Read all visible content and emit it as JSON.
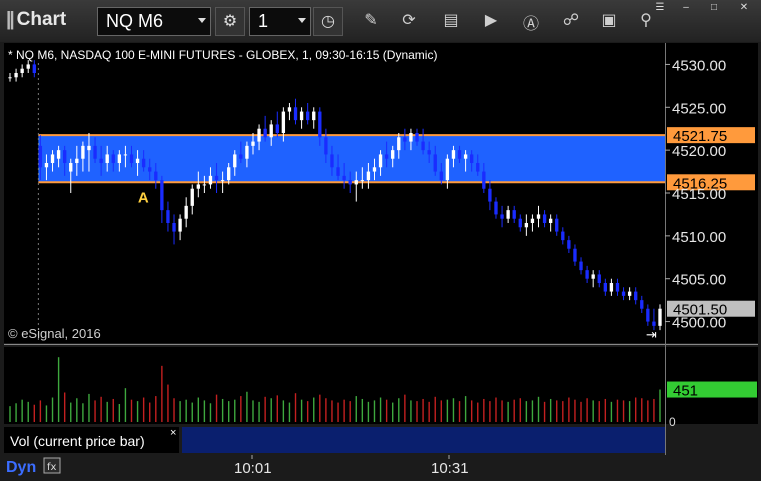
{
  "toolbar": {
    "app_title": "Chart",
    "symbol": "NQ M6",
    "interval": "1",
    "chart_title": "* NQ M6, NASDAQ 100 E-MINI FUTURES - GLOBEX, 1, 09:30-16:15 (Dynamic)",
    "copyright": "© eSignal, 2016",
    "dyn_label": "Dyn",
    "vol_panel_label": "Vol (current price bar)",
    "vol_close_glyph": "×",
    "note_letter": "A"
  },
  "colors": {
    "background": "#000000",
    "zone_fill": "#1f62ff",
    "zone_border": "#ff9a3c",
    "up_candle": "#ffffff",
    "down_candle": "#1a2cff",
    "vol_up": "#3ea83e",
    "vol_down": "#c42020",
    "last_price_tag": "#bfbfbf",
    "vol_tag": "#33cc33"
  },
  "chart_data": [
    {
      "type": "candlestick",
      "title": "* NQ M6, NASDAQ 100 E-MINI FUTURES - GLOBEX, 1, 09:30-16:15 (Dynamic)",
      "y_ticks": [
        "4530.00",
        "4525.00",
        "4520.00",
        "4515.00",
        "4510.00",
        "4505.00",
        "4500.00"
      ],
      "ylim": [
        4497.5,
        4532.5
      ],
      "x_ticks": [
        "10:01",
        "10:31"
      ],
      "zone": {
        "low": 4516.25,
        "high": 4521.75,
        "labels": [
          "4521.75",
          "4516.25"
        ]
      },
      "last_price": 4501.5,
      "last_price_label": "4501.50",
      "annotations": [
        {
          "text": "A",
          "bar": 25,
          "price": 4514.5
        }
      ],
      "bars": [
        [
          4528.5,
          4529.0,
          4528.0,
          4528.5
        ],
        [
          4528.5,
          4529.5,
          4528.0,
          4529.0
        ],
        [
          4529.0,
          4530.0,
          4528.5,
          4529.5
        ],
        [
          4529.5,
          4530.5,
          4529.0,
          4530.0
        ],
        [
          4530.0,
          4530.5,
          4528.5,
          4529.0
        ],
        [
          4520.5,
          4521.75,
          4516.5,
          4518.0
        ],
        [
          4518.0,
          4519.5,
          4516.5,
          4518.5
        ],
        [
          4518.5,
          4520.0,
          4517.5,
          4519.5
        ],
        [
          4519.0,
          4520.5,
          4518.0,
          4520.0
        ],
        [
          4520.0,
          4520.5,
          4517.0,
          4518.5
        ],
        [
          4517.5,
          4519.0,
          4515.0,
          4518.5
        ],
        [
          4518.5,
          4520.5,
          4517.0,
          4519.0
        ],
        [
          4519.0,
          4521.0,
          4517.5,
          4520.5
        ],
        [
          4520.0,
          4522.0,
          4517.5,
          4520.5
        ],
        [
          4520.5,
          4521.5,
          4518.5,
          4519.0
        ],
        [
          4519.0,
          4520.5,
          4517.0,
          4518.5
        ],
        [
          4518.5,
          4520.5,
          4517.5,
          4519.5
        ],
        [
          4519.5,
          4520.0,
          4517.5,
          4518.5
        ],
        [
          4518.5,
          4520.0,
          4517.5,
          4519.5
        ],
        [
          4519.5,
          4520.5,
          4518.0,
          4519.5
        ],
        [
          4519.5,
          4520.5,
          4518.0,
          4518.5
        ],
        [
          4518.5,
          4520.0,
          4517.0,
          4519.0
        ],
        [
          4519.0,
          4520.0,
          4517.5,
          4518.0
        ],
        [
          4518.0,
          4519.0,
          4516.5,
          4517.5
        ],
        [
          4517.5,
          4518.5,
          4515.5,
          4516.5
        ],
        [
          4516.5,
          4517.0,
          4511.5,
          4513.0
        ],
        [
          4513.0,
          4514.0,
          4510.5,
          4511.5
        ],
        [
          4511.5,
          4512.5,
          4509.0,
          4510.5
        ],
        [
          4510.5,
          4512.5,
          4509.5,
          4512.0
        ],
        [
          4512.0,
          4514.5,
          4511.0,
          4513.5
        ],
        [
          4513.5,
          4516.0,
          4512.5,
          4515.5
        ],
        [
          4515.5,
          4517.5,
          4514.5,
          4516.0
        ],
        [
          4516.0,
          4517.0,
          4515.0,
          4516.0
        ],
        [
          4516.0,
          4518.0,
          4515.5,
          4517.0
        ],
        [
          4517.0,
          4518.5,
          4515.0,
          4516.5
        ],
        [
          4516.5,
          4517.5,
          4515.0,
          4516.5
        ],
        [
          4516.5,
          4518.5,
          4516.0,
          4518.0
        ],
        [
          4518.0,
          4520.0,
          4517.0,
          4519.5
        ],
        [
          4519.5,
          4521.0,
          4518.5,
          4519.0
        ],
        [
          4519.0,
          4521.0,
          4518.0,
          4520.5
        ],
        [
          4520.5,
          4522.0,
          4519.5,
          4521.0
        ],
        [
          4521.0,
          4523.0,
          4520.0,
          4522.5
        ],
        [
          4522.5,
          4524.0,
          4521.0,
          4521.5
        ],
        [
          4521.5,
          4523.5,
          4520.5,
          4523.0
        ],
        [
          4523.0,
          4524.5,
          4521.5,
          4522.0
        ],
        [
          4522.0,
          4525.0,
          4521.0,
          4524.5
        ],
        [
          4524.5,
          4525.5,
          4523.5,
          4525.0
        ],
        [
          4525.0,
          4526.0,
          4523.0,
          4523.5
        ],
        [
          4523.5,
          4525.0,
          4522.5,
          4524.5
        ],
        [
          4524.5,
          4525.5,
          4523.0,
          4523.5
        ],
        [
          4523.5,
          4525.0,
          4522.5,
          4524.5
        ],
        [
          4524.5,
          4525.0,
          4520.5,
          4521.5
        ],
        [
          4521.5,
          4522.5,
          4518.5,
          4519.5
        ],
        [
          4519.5,
          4520.5,
          4517.0,
          4518.0
        ],
        [
          4518.0,
          4519.5,
          4516.5,
          4517.0
        ],
        [
          4517.0,
          4518.5,
          4515.5,
          4516.5
        ],
        [
          4516.5,
          4517.5,
          4515.0,
          4516.0
        ],
        [
          4516.0,
          4517.5,
          4514.0,
          4516.5
        ],
        [
          4516.5,
          4518.0,
          4515.5,
          4516.5
        ],
        [
          4516.5,
          4518.5,
          4515.5,
          4517.5
        ],
        [
          4517.5,
          4519.0,
          4516.5,
          4518.0
        ],
        [
          4518.0,
          4520.0,
          4517.0,
          4519.5
        ],
        [
          4519.5,
          4521.0,
          4518.0,
          4519.0
        ],
        [
          4519.0,
          4520.5,
          4518.0,
          4520.0
        ],
        [
          4520.0,
          4522.0,
          4519.0,
          4521.5
        ],
        [
          4521.5,
          4522.5,
          4520.0,
          4521.0
        ],
        [
          4521.0,
          4522.5,
          4520.0,
          4522.0
        ],
        [
          4522.0,
          4522.5,
          4520.5,
          4521.0
        ],
        [
          4521.0,
          4522.5,
          4519.5,
          4520.0
        ],
        [
          4520.0,
          4521.0,
          4518.5,
          4519.5
        ],
        [
          4519.5,
          4520.5,
          4517.0,
          4517.5
        ],
        [
          4517.5,
          4518.5,
          4516.0,
          4516.5
        ],
        [
          4516.5,
          4519.5,
          4515.5,
          4519.0
        ],
        [
          4519.0,
          4520.5,
          4518.0,
          4520.0
        ],
        [
          4520.0,
          4520.5,
          4518.5,
          4519.0
        ],
        [
          4519.0,
          4520.0,
          4517.5,
          4519.5
        ],
        [
          4519.5,
          4520.0,
          4517.5,
          4518.5
        ],
        [
          4518.5,
          4519.5,
          4517.0,
          4517.5
        ],
        [
          4517.5,
          4518.5,
          4515.0,
          4515.5
        ],
        [
          4515.5,
          4516.5,
          4513.0,
          4514.0
        ],
        [
          4514.0,
          4514.5,
          4512.0,
          4512.5
        ],
        [
          4512.5,
          4513.5,
          4511.0,
          4512.0
        ],
        [
          4512.0,
          4513.5,
          4511.5,
          4513.0
        ],
        [
          4513.0,
          4513.5,
          4511.5,
          4512.0
        ],
        [
          4512.0,
          4512.5,
          4510.5,
          4511.0
        ],
        [
          4511.0,
          4512.5,
          4510.0,
          4511.5
        ],
        [
          4511.5,
          4512.5,
          4510.5,
          4512.0
        ],
        [
          4512.0,
          4513.5,
          4511.0,
          4512.5
        ],
        [
          4512.5,
          4513.0,
          4511.0,
          4511.5
        ],
        [
          4511.5,
          4512.5,
          4510.5,
          4512.0
        ],
        [
          4512.0,
          4512.5,
          4510.0,
          4510.5
        ],
        [
          4510.5,
          4511.0,
          4509.0,
          4509.5
        ],
        [
          4509.5,
          4510.0,
          4508.0,
          4508.5
        ],
        [
          4508.5,
          4509.0,
          4506.5,
          4507.0
        ],
        [
          4507.0,
          4507.5,
          4505.5,
          4506.0
        ],
        [
          4506.0,
          4506.5,
          4504.5,
          4505.0
        ],
        [
          4505.0,
          4506.0,
          4504.0,
          4505.5
        ],
        [
          4505.5,
          4506.0,
          4504.0,
          4504.5
        ],
        [
          4504.5,
          4505.0,
          4503.0,
          4503.5
        ],
        [
          4503.5,
          4505.0,
          4503.0,
          4504.5
        ],
        [
          4504.5,
          4505.0,
          4503.0,
          4503.5
        ],
        [
          4503.5,
          4504.0,
          4502.5,
          4503.0
        ],
        [
          4503.0,
          4504.0,
          4502.5,
          4503.5
        ],
        [
          4503.5,
          4504.0,
          4502.0,
          4502.5
        ],
        [
          4502.5,
          4503.0,
          4501.0,
          4501.5
        ],
        [
          4501.5,
          4502.0,
          4499.5,
          4500.0
        ],
        [
          4500.0,
          4501.5,
          4499.0,
          4499.5
        ],
        [
          4499.5,
          4502.0,
          4499.0,
          4501.5
        ]
      ]
    },
    {
      "type": "bar",
      "title": "Vol (current price bar)",
      "last_value": 451,
      "last_value_label": "451",
      "y_tick_label": "0",
      "values": [
        220,
        260,
        310,
        280,
        240,
        300,
        230,
        340,
        900,
        410,
        270,
        330,
        260,
        390,
        300,
        350,
        280,
        320,
        250,
        470,
        310,
        290,
        340,
        270,
        360,
        780,
        520,
        330,
        290,
        310,
        270,
        340,
        300,
        260,
        380,
        320,
        290,
        310,
        360,
        420,
        300,
        280,
        350,
        330,
        370,
        300,
        270,
        400,
        310,
        290,
        340,
        380,
        330,
        300,
        270,
        310,
        290,
        360,
        320,
        280,
        300,
        340,
        310,
        270,
        330,
        380,
        300,
        290,
        320,
        280,
        350,
        300,
        310,
        330,
        290,
        360,
        300,
        270,
        320,
        290,
        340,
        300,
        280,
        310,
        330,
        290,
        300,
        350,
        280,
        320,
        300,
        290,
        340,
        310,
        280,
        330,
        300,
        290,
        320,
        280,
        310,
        300,
        290,
        340,
        330,
        300,
        320,
        451
      ]
    }
  ]
}
